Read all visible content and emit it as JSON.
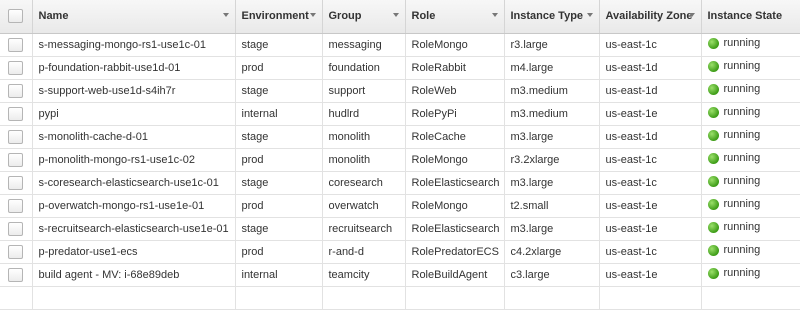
{
  "colors": {
    "running_status": "#3d9c17",
    "header_bg": "#eeeeee",
    "grid_line": "#e2e2e2"
  },
  "columns": [
    "Name",
    "Environment",
    "Group",
    "Role",
    "Instance Type",
    "Availability Zone",
    "Instance State"
  ],
  "rows": [
    [
      "s-messaging-mongo-rs1-use1c-01",
      "stage",
      "messaging",
      "RoleMongo",
      "r3.large",
      "us-east-1c",
      "running"
    ],
    [
      "p-foundation-rabbit-use1d-01",
      "prod",
      "foundation",
      "RoleRabbit",
      "m4.large",
      "us-east-1d",
      "running"
    ],
    [
      "s-support-web-use1d-s4ih7r",
      "stage",
      "support",
      "RoleWeb",
      "m3.medium",
      "us-east-1d",
      "running"
    ],
    [
      "pypi",
      "internal",
      "hudlrd",
      "RolePyPi",
      "m3.medium",
      "us-east-1e",
      "running"
    ],
    [
      "s-monolith-cache-d-01",
      "stage",
      "monolith",
      "RoleCache",
      "m3.large",
      "us-east-1d",
      "running"
    ],
    [
      "p-monolith-mongo-rs1-use1c-02",
      "prod",
      "monolith",
      "RoleMongo",
      "r3.2xlarge",
      "us-east-1c",
      "running"
    ],
    [
      "s-coresearch-elasticsearch-use1c-01",
      "stage",
      "coresearch",
      "RoleElasticsearch",
      "m3.large",
      "us-east-1c",
      "running"
    ],
    [
      "p-overwatch-mongo-rs1-use1e-01",
      "prod",
      "overwatch",
      "RoleMongo",
      "t2.small",
      "us-east-1e",
      "running"
    ],
    [
      "s-recruitsearch-elasticsearch-use1e-01",
      "stage",
      "recruitsearch",
      "RoleElasticsearch",
      "m3.large",
      "us-east-1e",
      "running"
    ],
    [
      "p-predator-use1-ecs",
      "prod",
      "r-and-d",
      "RolePredatorECS",
      "c4.2xlarge",
      "us-east-1c",
      "running"
    ],
    [
      "build agent - MV: i-68e89deb",
      "internal",
      "teamcity",
      "RoleBuildAgent",
      "c3.large",
      "us-east-1e",
      "running"
    ]
  ]
}
